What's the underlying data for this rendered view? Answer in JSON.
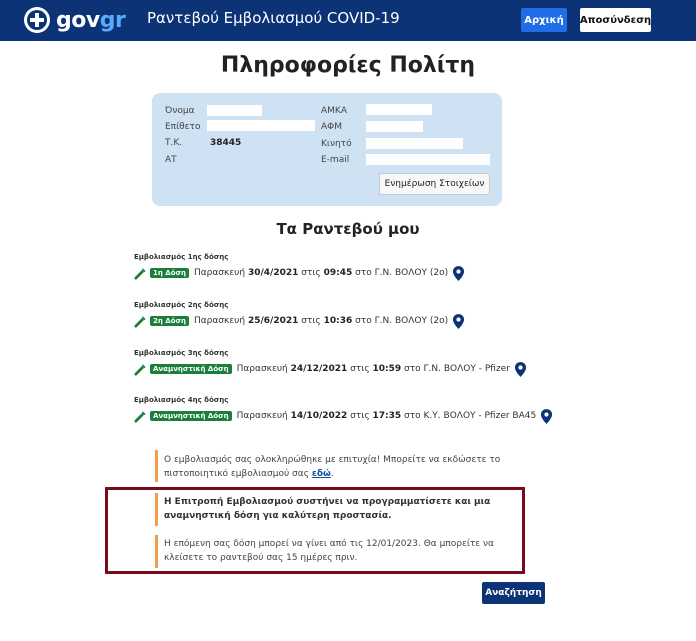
{
  "header": {
    "logo_main": "gov",
    "logo_accent": "gr",
    "title": "Ραντεβού Εμβολιασμού COVID-19",
    "home_label": "Αρχική",
    "logout_label": "Αποσύνδεση"
  },
  "page_title": "Πληροφορίες Πολίτη",
  "citizen": {
    "first_name_label": "Όνομα",
    "last_name_label": "Επίθετο",
    "postal_code_label": "Τ.Κ.",
    "postal_code_value": "38445",
    "id_label": "ΑΤ",
    "amka_label": "ΑΜΚΑ",
    "afm_label": "ΑΦΜ",
    "mobile_label": "Κινητό",
    "email_label": "E-mail",
    "update_button": "Ενημέρωση Στοιχείων"
  },
  "appointments_title": "Τα Ραντεβού μου",
  "appointments": [
    {
      "dose_title": "Εμβολιασμός 1ης δόσης",
      "badge": "1η Δόση",
      "day": "Παρασκευή",
      "date": "30/4/2021",
      "at": "στις",
      "time": "09:45",
      "in": "στο",
      "place": "Γ.Ν. ΒΟΛΟΥ (2ο)"
    },
    {
      "dose_title": "Εμβολιασμός 2ης δόσης",
      "badge": "2η Δόση",
      "day": "Παρασκευή",
      "date": "25/6/2021",
      "at": "στις",
      "time": "10:36",
      "in": "στο",
      "place": "Γ.Ν. ΒΟΛΟΥ (2ο)"
    },
    {
      "dose_title": "Εμβολιασμός 3ης δόσης",
      "badge": "Αναμνηστική Δόση",
      "day": "Παρασκευή",
      "date": "24/12/2021",
      "at": "στις",
      "time": "10:59",
      "in": "στο",
      "place": "Γ.Ν. ΒΟΛΟΥ - Pfizer"
    },
    {
      "dose_title": "Εμβολιασμός 4ης δόσης",
      "badge": "Αναμνηστική Δόση",
      "day": "Παρασκευή",
      "date": "14/10/2022",
      "at": "στις",
      "time": "17:35",
      "in": "στο",
      "place": "Κ.Υ. ΒΟΛΟΥ - Pfizer BA45"
    }
  ],
  "info": {
    "completed_text": "Ο εμβολιασμός σας ολοκληρώθηκε με επιτυχία! Μπορείτε να εκδώσετε το πιστοποιητικό εμβολιασμού σας",
    "completed_link": "εδώ",
    "completed_end": ".",
    "recommend_text": "Η Επιτροπή Εμβολιασμού συστήνει να προγραμματίσετε και μια αναμνηστική δόση για καλύτερη προστασία.",
    "next_dose_text": "Η επόμενη σας δόση μπορεί να γίνει από τις 12/01/2023. Θα μπορείτε να κλείσετε το ραντεβού σας 15 ημέρες πριν."
  },
  "search_button": "Αναζήτηση",
  "colors": {
    "header_bg": "#0b3375",
    "primary_button": "#1f6ee8",
    "badge_green": "#1b7f3b",
    "info_accent": "#f0a04b",
    "highlight_border": "#7b0b1c",
    "card_bg": "#cfe2f4"
  }
}
